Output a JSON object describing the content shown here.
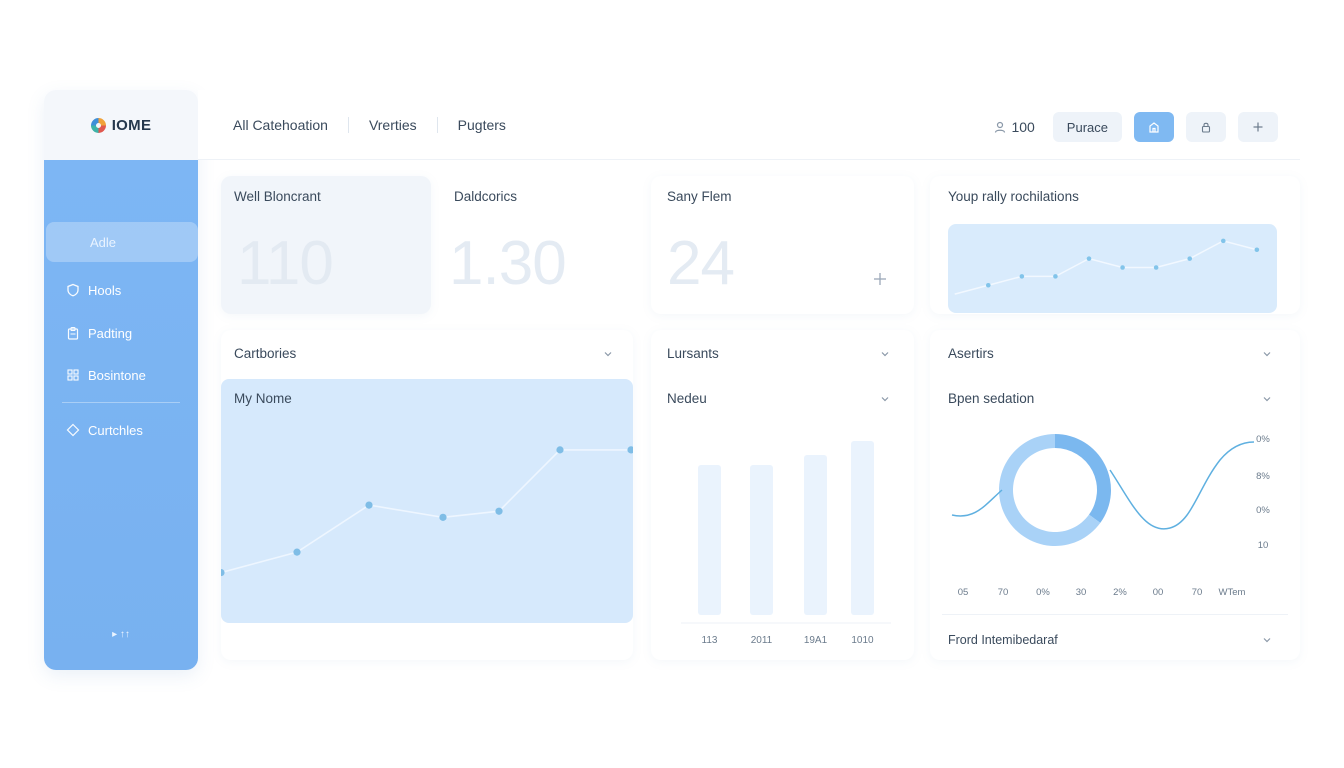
{
  "app": {
    "logo_text": "IOME"
  },
  "sidebar": {
    "items": [
      {
        "label": "Adle",
        "icon": "none",
        "active": true
      },
      {
        "label": "Hools",
        "icon": "shield-icon"
      },
      {
        "label": "Padting",
        "icon": "clipboard-icon"
      },
      {
        "label": "Bosintone",
        "icon": "grid-icon"
      },
      {
        "label": "Curtchles",
        "icon": "tag-icon"
      }
    ],
    "footer": "▸ ↑↑"
  },
  "topbar": {
    "nav": [
      "All Catehoation",
      "Vrerties",
      "Pugters"
    ],
    "count": "100",
    "purchase_label": "Purace",
    "colors": {
      "primary": "#7fb9f2",
      "sidebar": "#7db6f4"
    }
  },
  "stats": [
    {
      "title": "Well Bloncrant",
      "value": "110"
    },
    {
      "title": "Daldcorics",
      "value": "1.30"
    },
    {
      "title": "Sany Flem",
      "value": "24"
    }
  ],
  "insights": {
    "title": "Youp rally rochilations"
  },
  "filters": {
    "left": "Cartbories",
    "middle": "Lursants",
    "right": "Asertirs",
    "middle_sub": "Nedeu",
    "right_sub": "Bpen sedation",
    "bottom": "Frord Intemibedaraf"
  },
  "chart_panel": {
    "title": "My Nome"
  },
  "chart_data": [
    {
      "type": "line",
      "title": "Youp rally rochilations",
      "values": [
        1,
        2,
        3,
        3,
        5,
        4,
        4,
        5,
        7,
        6
      ]
    },
    {
      "type": "line",
      "title": "My Nome",
      "values": [
        1,
        2,
        4.3,
        3.7,
        4,
        7,
        7
      ]
    },
    {
      "type": "bar",
      "title": "Nedeu",
      "categories": [
        "113",
        "2011",
        "19A1",
        "1010"
      ],
      "values": [
        150,
        150,
        160,
        174
      ],
      "ylim": [
        0,
        200
      ]
    },
    {
      "type": "pie",
      "title": "Bpen sedation",
      "values": [
        35,
        65
      ],
      "x_ticks": [
        "05",
        "70",
        "0%",
        "30",
        "2%",
        "00",
        "70",
        "WTem"
      ],
      "y_ticks": [
        "0%",
        "8%",
        "0%",
        "10"
      ]
    }
  ]
}
